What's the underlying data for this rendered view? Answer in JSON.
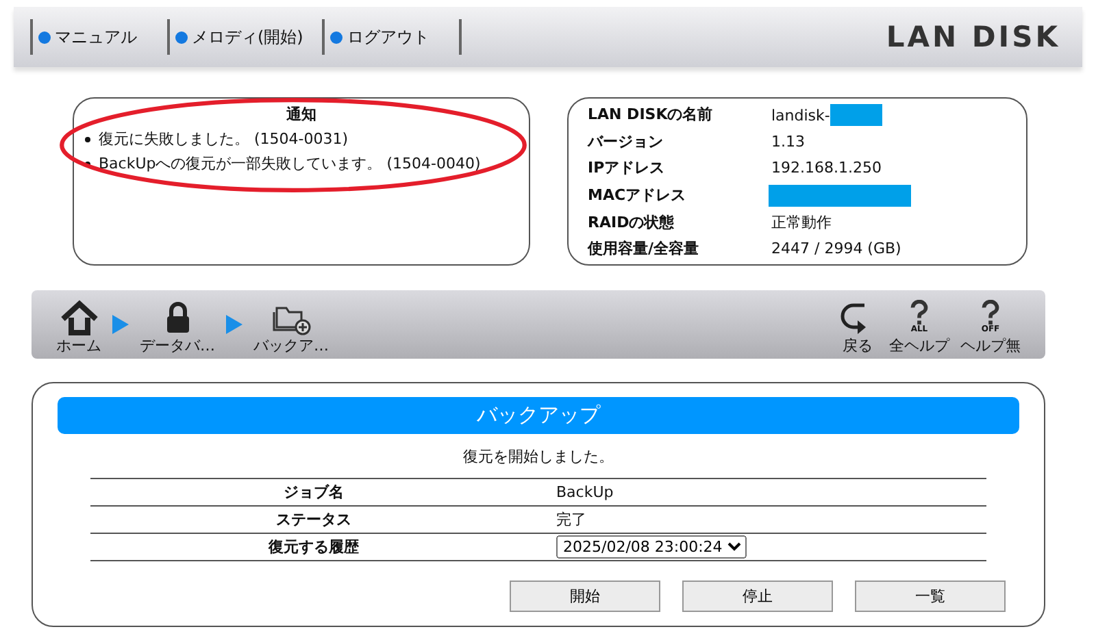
{
  "header": {
    "links": [
      "マニュアル",
      "メロディ(開始)",
      "ログアウト"
    ],
    "logo": "LAN DISK"
  },
  "notice": {
    "title": "通知",
    "items": [
      "復元に失敗しました。 (1504-0031)",
      "BackUpへの復元が一部失敗しています。 (1504-0040)"
    ],
    "highlighted": true
  },
  "info": [
    {
      "label": "LAN DISKの名前",
      "value": "landisk-",
      "redacted": true
    },
    {
      "label": "バージョン",
      "value": "1.13"
    },
    {
      "label": "IPアドレス",
      "value": "192.168.1.250"
    },
    {
      "label": "MACアドレス",
      "redacted": true
    },
    {
      "label": "RAIDの状態",
      "value": "正常動作"
    },
    {
      "label": "使用容量/全容量",
      "value": "2447 / 2994 (GB)"
    }
  ],
  "breadcrumb": [
    {
      "kind": "home",
      "label": "ホーム"
    },
    {
      "kind": "lock",
      "label": "データバ…"
    },
    {
      "kind": "folder",
      "label": "バックア…"
    }
  ],
  "tools": [
    {
      "kind": "back",
      "label": "戻る"
    },
    {
      "kind": "help",
      "badge": "ALL",
      "label": "全ヘルプ"
    },
    {
      "kind": "help",
      "badge": "OFF",
      "label": "ヘルプ無"
    }
  ],
  "panel": {
    "title": "バックアップ",
    "message": "復元を開始しました。",
    "rows": [
      {
        "kind": "text",
        "label": "ジョブ名",
        "value": "BackUp"
      },
      {
        "kind": "text",
        "label": "ステータス",
        "value": "完了"
      },
      {
        "kind": "select",
        "label": "復元する履歴",
        "value": "2025/02/08 23:00:24"
      }
    ],
    "buttons": [
      "開始",
      "停止",
      "一覧"
    ]
  }
}
